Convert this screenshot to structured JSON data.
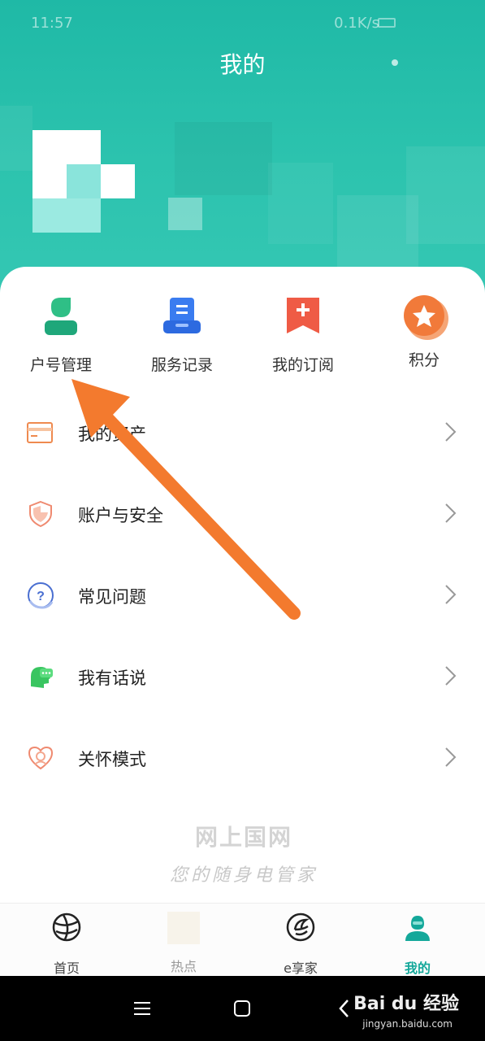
{
  "status": {
    "time": "11:57",
    "right": "0.1K/s"
  },
  "header": {
    "title": "我的"
  },
  "quick_actions": [
    {
      "label": "户号管理",
      "icon": "account-manage-icon"
    },
    {
      "label": "服务记录",
      "icon": "service-record-icon"
    },
    {
      "label": "我的订阅",
      "icon": "subscription-icon"
    },
    {
      "label": "积分",
      "icon": "points-star-icon"
    }
  ],
  "menu": [
    {
      "label": "我的资产",
      "icon": "card-icon"
    },
    {
      "label": "账户与安全",
      "icon": "shield-icon"
    },
    {
      "label": "常见问题",
      "icon": "question-icon"
    },
    {
      "label": "我有话说",
      "icon": "chat-head-icon"
    },
    {
      "label": "关怀模式",
      "icon": "heart-care-icon"
    }
  ],
  "watermark": {
    "title": "网上国网",
    "subtitle": "您的随身电管家"
  },
  "tabs": [
    {
      "label": "首页",
      "icon": "globe-icon",
      "active": false
    },
    {
      "label": "热点",
      "icon": "hot-icon",
      "active": false
    },
    {
      "label": "e享家",
      "icon": "e-home-icon",
      "active": false
    },
    {
      "label": "我的",
      "icon": "profile-icon",
      "active": true
    }
  ],
  "branding": {
    "text": "Bai du 经验",
    "sub": "jingyan.baidu.com"
  },
  "colors": {
    "accent": "#14a89a",
    "header": "#2cc3ae",
    "arrow": "#f37a2e"
  }
}
